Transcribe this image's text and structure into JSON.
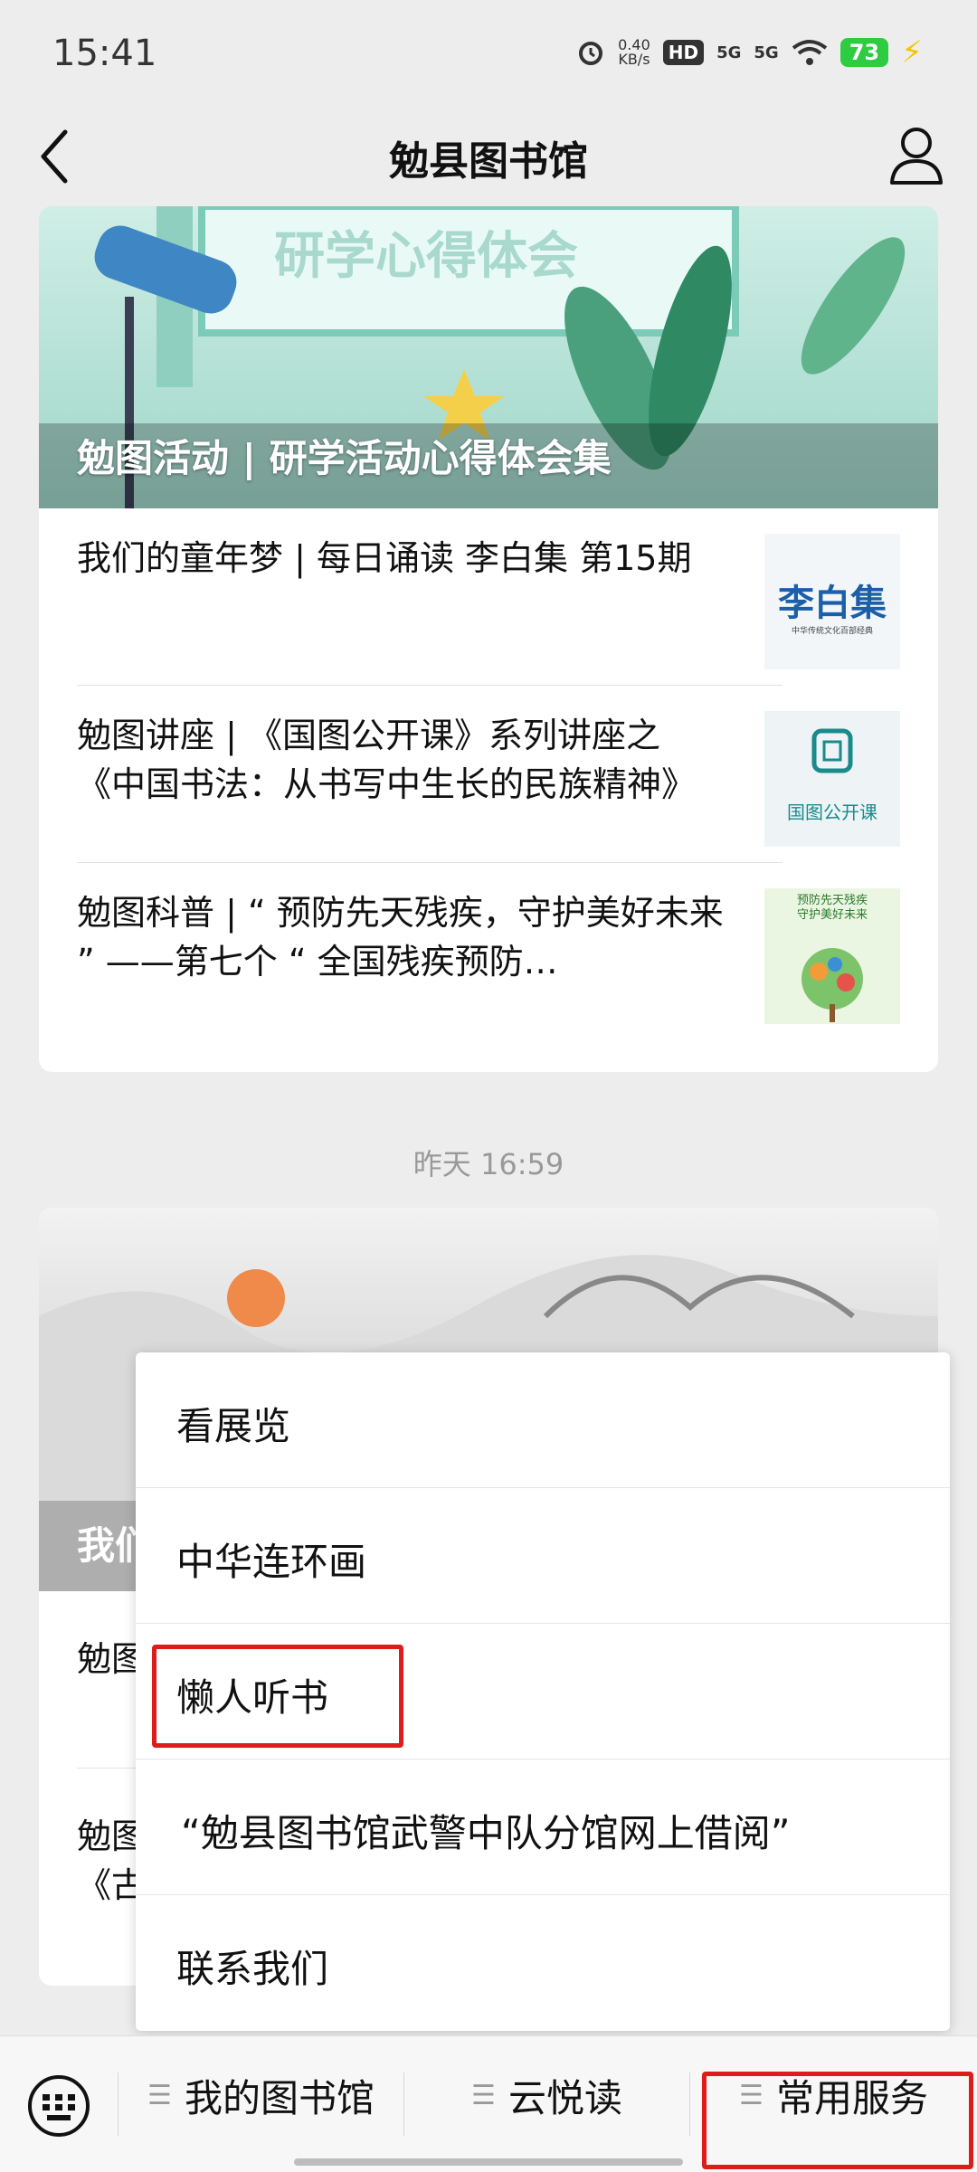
{
  "status_bar": {
    "time": "15:41",
    "net_speed": "0.40",
    "net_unit": "KB/s",
    "hd_label": "HD",
    "signal_1": "5G",
    "signal_2": "5G",
    "battery": "73",
    "icons": [
      "alarm-icon",
      "hd-icon",
      "signal-icon",
      "signal-icon",
      "wifi-icon",
      "battery-icon",
      "charging-icon"
    ]
  },
  "navbar": {
    "title": "勉县图书馆",
    "back_icon": "chevron-left-icon",
    "profile_icon": "user-icon"
  },
  "feed": {
    "card1": {
      "cover_banner_text": "研学心得体会",
      "cover_caption": "勉图活动 | 研学活动心得体会集",
      "articles": [
        {
          "title": "我们的童年梦 | 每日诵读  李白集 第15期",
          "thumb_text": "李白集",
          "thumb_sub": "中华传统文化百部经典"
        },
        {
          "title": "勉图讲座 | 《国图公开课》系列讲座之《中国书法：从书写中生长的民族精神》",
          "thumb_text": "国图公开课"
        },
        {
          "title": "勉图科普 | “ 预防先天残疾，守护美好未来 ” ——第七个 “ 全国残疾预防…",
          "thumb_text": "预防先天残疾\n守护美好未来"
        }
      ]
    },
    "timestamp": "昨天 16:59",
    "card2": {
      "cover_caption_partial": "我们",
      "articles": [
        {
          "title_partial": "勉图"
        },
        {
          "title_partial_1": "勉图",
          "title_partial_2": "《古"
        }
      ]
    }
  },
  "popup_menu": {
    "items": [
      {
        "label": "看展览"
      },
      {
        "label": "中华连环画"
      },
      {
        "label": "懒人听书"
      },
      {
        "label": "“勉县图书馆武警中队分馆网上借阅”"
      },
      {
        "label": "联系我们"
      }
    ]
  },
  "bottom_bar": {
    "keyboard_icon": "keyboard-icon",
    "tabs": [
      {
        "label": "我的图书馆"
      },
      {
        "label": "云悦读"
      },
      {
        "label": "常用服务"
      }
    ]
  },
  "colors": {
    "highlight": "#e01b1b",
    "background": "#ededed"
  }
}
